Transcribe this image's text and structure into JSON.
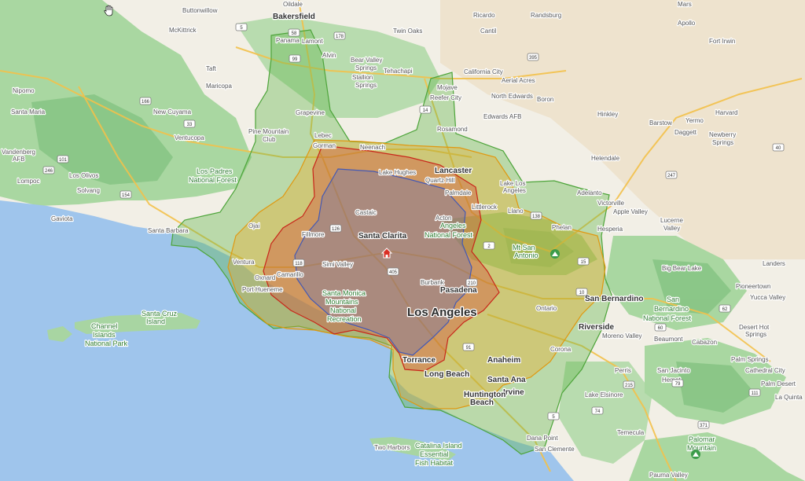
{
  "map": {
    "colors": {
      "land": "#f2efe6",
      "ocean": "#9fc5ec",
      "vegetation": "#a8d5a2",
      "vegetation_dark": "#7fc07d",
      "desert": "#e6d4b8",
      "road_major": "#f3c14b",
      "zone_green": "#5fb54a",
      "zone_yellow": "#f0a820",
      "zone_red": "#d8362a",
      "zone_blue": "#5469c4",
      "home": "#d93025"
    },
    "icons": [
      "home-icon",
      "hand-cursor-icon",
      "mountain-peak-icon"
    ],
    "zones": [
      {
        "name": "outer-green",
        "color": "#5fb54a"
      },
      {
        "name": "yellow",
        "color": "#f0a820"
      },
      {
        "name": "red",
        "color": "#d8362a"
      },
      {
        "name": "blue",
        "color": "#5469c4"
      }
    ],
    "labels": {
      "major": [
        {
          "id": "los-angeles",
          "text": "Los Angeles"
        }
      ],
      "medium": [
        {
          "id": "bakersfield",
          "text": "Bakersfield"
        },
        {
          "id": "santa-clarita",
          "text": "Santa Clarita"
        },
        {
          "id": "lancaster",
          "text": "Lancaster"
        },
        {
          "id": "pasadena",
          "text": "Pasadena"
        },
        {
          "id": "san-bernardino",
          "text": "San Bernardino"
        },
        {
          "id": "riverside",
          "text": "Riverside"
        },
        {
          "id": "anaheim",
          "text": "Anaheim"
        },
        {
          "id": "santa-ana",
          "text": "Santa Ana"
        },
        {
          "id": "long-beach",
          "text": "Long Beach"
        },
        {
          "id": "torrance",
          "text": "Torrance"
        },
        {
          "id": "irvine",
          "text": "Irvine"
        },
        {
          "id": "huntington-beach-1",
          "text": "Huntington"
        },
        {
          "id": "huntington-beach-2",
          "text": "Beach"
        }
      ],
      "small": [
        {
          "id": "oildale",
          "text": "Oildale"
        },
        {
          "id": "buttonwillow",
          "text": "Buttonwillow"
        },
        {
          "id": "mckittrick",
          "text": "McKittrick"
        },
        {
          "id": "taft",
          "text": "Taft"
        },
        {
          "id": "maricopa",
          "text": "Maricopa"
        },
        {
          "id": "new-cuyama",
          "text": "New Cuyama"
        },
        {
          "id": "ventucopa",
          "text": "Ventucopa"
        },
        {
          "id": "nipomo",
          "text": "Nipomo"
        },
        {
          "id": "santa-maria",
          "text": "Santa Maria"
        },
        {
          "id": "vandenberg-1",
          "text": "Vandenberg"
        },
        {
          "id": "vandenberg-2",
          "text": "AFB"
        },
        {
          "id": "lompoc",
          "text": "Lompoc"
        },
        {
          "id": "los-olivos",
          "text": "Los Olivos"
        },
        {
          "id": "solvang",
          "text": "Solvang"
        },
        {
          "id": "gaviota",
          "text": "Gaviota"
        },
        {
          "id": "santa-barbara",
          "text": "Santa Barbara"
        },
        {
          "id": "ojai",
          "text": "Ojai"
        },
        {
          "id": "ventura",
          "text": "Ventura"
        },
        {
          "id": "oxnard",
          "text": "Oxnard"
        },
        {
          "id": "camarillo",
          "text": "Camarillo"
        },
        {
          "id": "port-hueneme",
          "text": "Port Hueneme"
        },
        {
          "id": "fillmore",
          "text": "Fillmore"
        },
        {
          "id": "simi-valley",
          "text": "Simi Valley"
        },
        {
          "id": "castaic",
          "text": "Castaic"
        },
        {
          "id": "burbank",
          "text": "Burbank"
        },
        {
          "id": "acton",
          "text": "Acton"
        },
        {
          "id": "palmdale",
          "text": "Palmdale"
        },
        {
          "id": "quartz-hill",
          "text": "Quartz Hill"
        },
        {
          "id": "lake-hughes",
          "text": "Lake Hughes"
        },
        {
          "id": "neenach",
          "text": "Neenach"
        },
        {
          "id": "rosamond",
          "text": "Rosamond"
        },
        {
          "id": "mojave",
          "text": "Mojave"
        },
        {
          "id": "reefer-city",
          "text": "Reefer City"
        },
        {
          "id": "edwards-afb",
          "text": "Edwards AFB"
        },
        {
          "id": "north-edwards",
          "text": "North Edwards"
        },
        {
          "id": "boron",
          "text": "Boron"
        },
        {
          "id": "california-city",
          "text": "California City"
        },
        {
          "id": "aerial-acres",
          "text": "Aerial Acres"
        },
        {
          "id": "tehachapi",
          "text": "Tehachapi"
        },
        {
          "id": "bear-valley-springs-1",
          "text": "Bear Valley"
        },
        {
          "id": "bear-valley-springs-2",
          "text": "Springs"
        },
        {
          "id": "stallion-springs-1",
          "text": "Stallion"
        },
        {
          "id": "stallion-springs-2",
          "text": "Springs"
        },
        {
          "id": "twin-oaks",
          "text": "Twin Oaks"
        },
        {
          "id": "ricardo",
          "text": "Ricardo"
        },
        {
          "id": "randsburg",
          "text": "Randsburg"
        },
        {
          "id": "cantil",
          "text": "Cantil"
        },
        {
          "id": "mars",
          "text": "Mars"
        },
        {
          "id": "apollo",
          "text": "Apollo"
        },
        {
          "id": "fort-irwin",
          "text": "Fort Irwin"
        },
        {
          "id": "harvard",
          "text": "Harvard"
        },
        {
          "id": "yermo",
          "text": "Yermo"
        },
        {
          "id": "barstow",
          "text": "Barstow"
        },
        {
          "id": "daggett",
          "text": "Daggett"
        },
        {
          "id": "newberry-springs-1",
          "text": "Newberry"
        },
        {
          "id": "newberry-springs-2",
          "text": "Springs"
        },
        {
          "id": "hinkley",
          "text": "Hinkley"
        },
        {
          "id": "helendale",
          "text": "Helendale"
        },
        {
          "id": "adelanto",
          "text": "Adelanto"
        },
        {
          "id": "victorville",
          "text": "Victorville"
        },
        {
          "id": "apple-valley",
          "text": "Apple Valley"
        },
        {
          "id": "lucerne-valley-1",
          "text": "Lucerne"
        },
        {
          "id": "lucerne-valley-2",
          "text": "Valley"
        },
        {
          "id": "hesperia",
          "text": "Hesperia"
        },
        {
          "id": "phelan",
          "text": "Phelan"
        },
        {
          "id": "llano",
          "text": "Llano"
        },
        {
          "id": "littlerock",
          "text": "Littlerock"
        },
        {
          "id": "lake-los-angeles-1",
          "text": "Lake Los"
        },
        {
          "id": "lake-los-angeles-2",
          "text": "Angeles"
        },
        {
          "id": "panama",
          "text": "Panama"
        },
        {
          "id": "lamont",
          "text": "Lamont"
        },
        {
          "id": "alvin",
          "text": "Alvin"
        },
        {
          "id": "grapevine",
          "text": "Grapevine"
        },
        {
          "id": "lebec",
          "text": "Lebec"
        },
        {
          "id": "gorman",
          "text": "Gorman"
        },
        {
          "id": "pine-mountain-club-1",
          "text": "Pine Mountain"
        },
        {
          "id": "pine-mountain-club-2",
          "text": "Club"
        },
        {
          "id": "landers",
          "text": "Landers"
        },
        {
          "id": "big-bear-lake",
          "text": "Big Bear Lake"
        },
        {
          "id": "pioneertown",
          "text": "Pioneertown"
        },
        {
          "id": "yucca-valley",
          "text": "Yucca Valley"
        },
        {
          "id": "desert-hot-springs-1",
          "text": "Desert Hot"
        },
        {
          "id": "desert-hot-springs-2",
          "text": "Springs"
        },
        {
          "id": "cabazon",
          "text": "Cabazon"
        },
        {
          "id": "beaumont",
          "text": "Beaumont"
        },
        {
          "id": "moreno-valley",
          "text": "Moreno Valley"
        },
        {
          "id": "ontario",
          "text": "Ontario"
        },
        {
          "id": "corona",
          "text": "Corona"
        },
        {
          "id": "perris",
          "text": "Perris"
        },
        {
          "id": "san-jacinto",
          "text": "San Jacinto"
        },
        {
          "id": "hemet",
          "text": "Hemet"
        },
        {
          "id": "palm-springs",
          "text": "Palm Springs"
        },
        {
          "id": "cathedral-city",
          "text": "Cathedral City"
        },
        {
          "id": "palm-desert",
          "text": "Palm Desert"
        },
        {
          "id": "la-quinta",
          "text": "La Quinta"
        },
        {
          "id": "lake-elsinore",
          "text": "Lake Elsinore"
        },
        {
          "id": "temecula",
          "text": "Temecula"
        },
        {
          "id": "dana-point",
          "text": "Dana Point"
        },
        {
          "id": "san-clemente",
          "text": "San Clemente"
        },
        {
          "id": "two-harbors",
          "text": "Two Harbors"
        },
        {
          "id": "pauma-valley",
          "text": "Pauma Valley"
        }
      ],
      "parks": [
        {
          "id": "los-padres-1",
          "text": "Los Padres"
        },
        {
          "id": "los-padres-2",
          "text": "National Forest"
        },
        {
          "id": "angeles-nf-1",
          "text": "Angeles"
        },
        {
          "id": "angeles-nf-2",
          "text": "National Forest"
        },
        {
          "id": "mt-san-antonio-1",
          "text": "Mt San"
        },
        {
          "id": "mt-san-antonio-2",
          "text": "Antonio"
        },
        {
          "id": "san-bernardino-nf-1",
          "text": "San"
        },
        {
          "id": "san-bernardino-nf-2",
          "text": "Bernardino"
        },
        {
          "id": "san-bernardino-nf-3",
          "text": "National Forest"
        },
        {
          "id": "santa-monica-mtns-1",
          "text": "Santa Monica"
        },
        {
          "id": "santa-monica-mtns-2",
          "text": "Mountains"
        },
        {
          "id": "santa-monica-mtns-3",
          "text": "National"
        },
        {
          "id": "santa-monica-mtns-4",
          "text": "Recreation"
        },
        {
          "id": "channel-islands-1",
          "text": "Channel"
        },
        {
          "id": "channel-islands-2",
          "text": "Islands"
        },
        {
          "id": "channel-islands-3",
          "text": "National Park"
        },
        {
          "id": "santa-cruz-island-1",
          "text": "Santa Cruz"
        },
        {
          "id": "santa-cruz-island-2",
          "text": "Island"
        },
        {
          "id": "catalina-1",
          "text": "Catalina Island"
        },
        {
          "id": "catalina-2",
          "text": "Essential"
        },
        {
          "id": "catalina-3",
          "text": "Fish Habitat"
        },
        {
          "id": "palomar-1",
          "text": "Palomar"
        },
        {
          "id": "palomar-2",
          "text": "Mountain"
        }
      ],
      "shields": [
        {
          "id": "s-178",
          "text": "178"
        },
        {
          "id": "s-58",
          "text": "58"
        },
        {
          "id": "s-99",
          "text": "99"
        },
        {
          "id": "s-5a",
          "text": "5"
        },
        {
          "id": "s-14",
          "text": "14"
        },
        {
          "id": "s-395",
          "text": "395"
        },
        {
          "id": "s-166",
          "text": "166"
        },
        {
          "id": "s-33",
          "text": "33"
        },
        {
          "id": "s-101",
          "text": "101"
        },
        {
          "id": "s-246",
          "text": "246"
        },
        {
          "id": "s-154",
          "text": "154"
        },
        {
          "id": "s-126",
          "text": "126"
        },
        {
          "id": "s-118",
          "text": "118"
        },
        {
          "id": "s-138",
          "text": "138"
        },
        {
          "id": "s-2",
          "text": "2"
        },
        {
          "id": "s-210",
          "text": "210"
        },
        {
          "id": "s-405",
          "text": "405"
        },
        {
          "id": "s-10",
          "text": "10"
        },
        {
          "id": "s-15",
          "text": "15"
        },
        {
          "id": "s-215",
          "text": "215"
        },
        {
          "id": "s-91",
          "text": "91"
        },
        {
          "id": "s-60",
          "text": "60"
        },
        {
          "id": "s-74",
          "text": "74"
        },
        {
          "id": "s-79",
          "text": "79"
        },
        {
          "id": "s-40",
          "text": "40"
        },
        {
          "id": "s-247",
          "text": "247"
        },
        {
          "id": "s-62",
          "text": "62"
        },
        {
          "id": "s-111",
          "text": "111"
        },
        {
          "id": "s-371",
          "text": "371"
        },
        {
          "id": "s-5b",
          "text": "5"
        }
      ]
    }
  }
}
